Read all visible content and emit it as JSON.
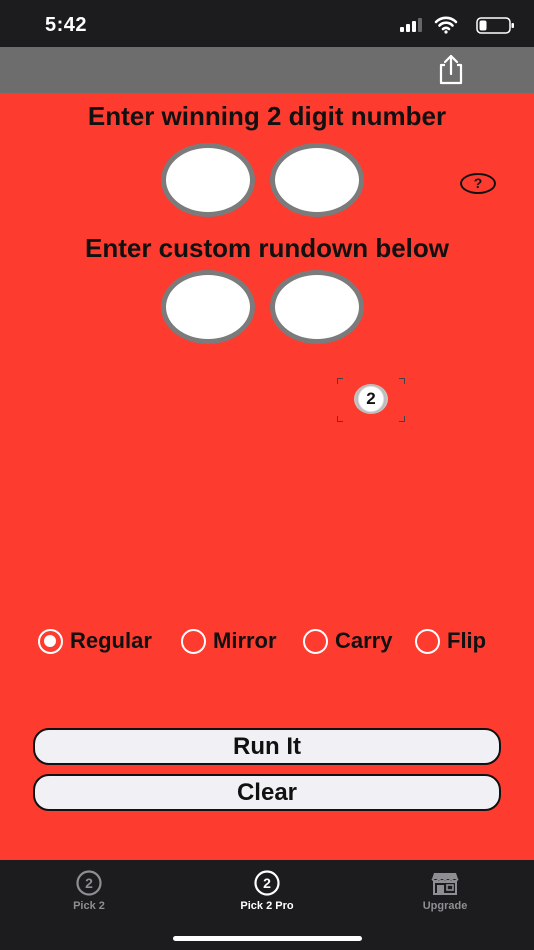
{
  "status_bar": {
    "time": "5:42"
  },
  "header": {
    "winning_title": "Enter winning 2 digit number",
    "custom_title": "Enter custom rundown below",
    "help_label": "?"
  },
  "ball": {
    "label": "2"
  },
  "options": [
    {
      "label": "Regular",
      "checked": true
    },
    {
      "label": "Mirror",
      "checked": false
    },
    {
      "label": "Carry",
      "checked": false
    },
    {
      "label": "Flip",
      "checked": false
    }
  ],
  "buttons": {
    "run": "Run It",
    "clear": "Clear"
  },
  "tabs": [
    {
      "label": "Pick 2",
      "icon": "circled-2-icon",
      "active": false
    },
    {
      "label": "Pick 2 Pro",
      "icon": "circled-2-icon",
      "active": true
    },
    {
      "label": "Upgrade",
      "icon": "store-icon",
      "active": false
    }
  ],
  "colors": {
    "background": "#fe3b2f",
    "nav_bar": "#6d6d6d",
    "tab_bar": "#1c1c1e",
    "button_fill": "#f1f1f5"
  }
}
